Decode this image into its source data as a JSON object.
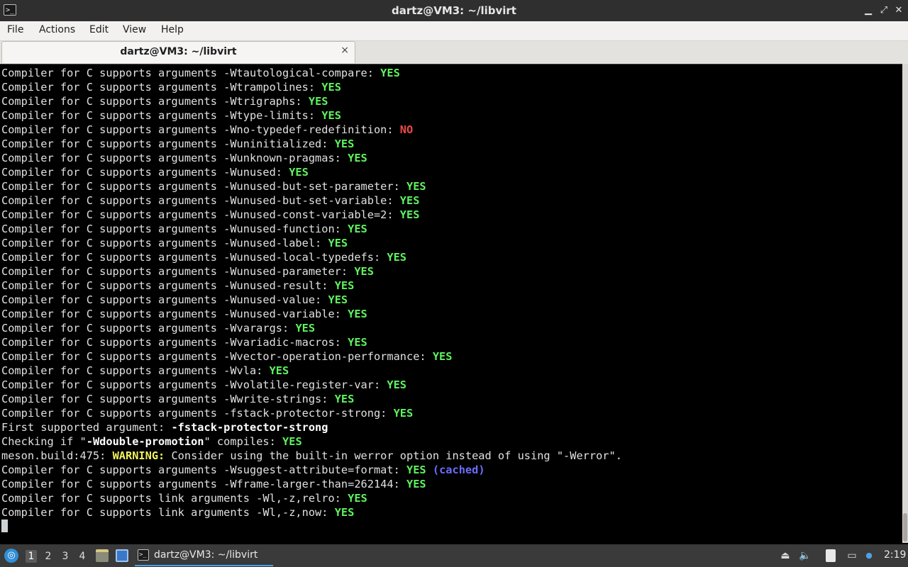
{
  "window": {
    "title": "dartz@VM3: ~/libvirt",
    "icon": "terminal-icon",
    "controls": {
      "minimize": "▁",
      "restore": "⤢",
      "close": "✕"
    }
  },
  "menubar": {
    "items": [
      "File",
      "Actions",
      "Edit",
      "View",
      "Help"
    ]
  },
  "tab": {
    "label": "dartz@VM3: ~/libvirt",
    "close": "×"
  },
  "terminal": {
    "colors": {
      "yes": "#5ef35e",
      "no": "#f04848",
      "warning": "#f2f25c",
      "cached": "#6c6cff",
      "text": "#e0e0e0"
    },
    "lines": [
      [
        {
          "t": "Compiler for C supports arguments -Wtautological-compare: "
        },
        {
          "t": "YES",
          "c": "yes"
        }
      ],
      [
        {
          "t": "Compiler for C supports arguments -Wtrampolines: "
        },
        {
          "t": "YES",
          "c": "yes"
        }
      ],
      [
        {
          "t": "Compiler for C supports arguments -Wtrigraphs: "
        },
        {
          "t": "YES",
          "c": "yes"
        }
      ],
      [
        {
          "t": "Compiler for C supports arguments -Wtype-limits: "
        },
        {
          "t": "YES",
          "c": "yes"
        }
      ],
      [
        {
          "t": "Compiler for C supports arguments -Wno-typedef-redefinition: "
        },
        {
          "t": "NO",
          "c": "no"
        }
      ],
      [
        {
          "t": "Compiler for C supports arguments -Wuninitialized: "
        },
        {
          "t": "YES",
          "c": "yes"
        }
      ],
      [
        {
          "t": "Compiler for C supports arguments -Wunknown-pragmas: "
        },
        {
          "t": "YES",
          "c": "yes"
        }
      ],
      [
        {
          "t": "Compiler for C supports arguments -Wunused: "
        },
        {
          "t": "YES",
          "c": "yes"
        }
      ],
      [
        {
          "t": "Compiler for C supports arguments -Wunused-but-set-parameter: "
        },
        {
          "t": "YES",
          "c": "yes"
        }
      ],
      [
        {
          "t": "Compiler for C supports arguments -Wunused-but-set-variable: "
        },
        {
          "t": "YES",
          "c": "yes"
        }
      ],
      [
        {
          "t": "Compiler for C supports arguments -Wunused-const-variable=2: "
        },
        {
          "t": "YES",
          "c": "yes"
        }
      ],
      [
        {
          "t": "Compiler for C supports arguments -Wunused-function: "
        },
        {
          "t": "YES",
          "c": "yes"
        }
      ],
      [
        {
          "t": "Compiler for C supports arguments -Wunused-label: "
        },
        {
          "t": "YES",
          "c": "yes"
        }
      ],
      [
        {
          "t": "Compiler for C supports arguments -Wunused-local-typedefs: "
        },
        {
          "t": "YES",
          "c": "yes"
        }
      ],
      [
        {
          "t": "Compiler for C supports arguments -Wunused-parameter: "
        },
        {
          "t": "YES",
          "c": "yes"
        }
      ],
      [
        {
          "t": "Compiler for C supports arguments -Wunused-result: "
        },
        {
          "t": "YES",
          "c": "yes"
        }
      ],
      [
        {
          "t": "Compiler for C supports arguments -Wunused-value: "
        },
        {
          "t": "YES",
          "c": "yes"
        }
      ],
      [
        {
          "t": "Compiler for C supports arguments -Wunused-variable: "
        },
        {
          "t": "YES",
          "c": "yes"
        }
      ],
      [
        {
          "t": "Compiler for C supports arguments -Wvarargs: "
        },
        {
          "t": "YES",
          "c": "yes"
        }
      ],
      [
        {
          "t": "Compiler for C supports arguments -Wvariadic-macros: "
        },
        {
          "t": "YES",
          "c": "yes"
        }
      ],
      [
        {
          "t": "Compiler for C supports arguments -Wvector-operation-performance: "
        },
        {
          "t": "YES",
          "c": "yes"
        }
      ],
      [
        {
          "t": "Compiler for C supports arguments -Wvla: "
        },
        {
          "t": "YES",
          "c": "yes"
        }
      ],
      [
        {
          "t": "Compiler for C supports arguments -Wvolatile-register-var: "
        },
        {
          "t": "YES",
          "c": "yes"
        }
      ],
      [
        {
          "t": "Compiler for C supports arguments -Wwrite-strings: "
        },
        {
          "t": "YES",
          "c": "yes"
        }
      ],
      [
        {
          "t": "Compiler for C supports arguments -fstack-protector-strong: "
        },
        {
          "t": "YES",
          "c": "yes"
        }
      ],
      [
        {
          "t": "First supported argument: "
        },
        {
          "t": "-fstack-protector-strong",
          "c": "boldw"
        }
      ],
      [
        {
          "t": "Checking if \""
        },
        {
          "t": "-Wdouble-promotion",
          "c": "boldw"
        },
        {
          "t": "\" compiles: "
        },
        {
          "t": "YES",
          "c": "yes"
        }
      ],
      [
        {
          "t": "meson.build:475: "
        },
        {
          "t": "WARNING:",
          "c": "warn"
        },
        {
          "t": " Consider using the built-in werror option instead of using \"-Werror\"."
        }
      ],
      [
        {
          "t": "Compiler for C supports arguments -Wsuggest-attribute=format: "
        },
        {
          "t": "YES",
          "c": "yes"
        },
        {
          "t": " "
        },
        {
          "t": "(cached)",
          "c": "cached"
        }
      ],
      [
        {
          "t": "Compiler for C supports arguments -Wframe-larger-than=262144: "
        },
        {
          "t": "YES",
          "c": "yes"
        }
      ],
      [
        {
          "t": "Compiler for C supports link arguments -Wl,-z,relro: "
        },
        {
          "t": "YES",
          "c": "yes"
        }
      ],
      [
        {
          "t": "Compiler for C supports link arguments -Wl,-z,now: "
        },
        {
          "t": "YES",
          "c": "yes"
        }
      ]
    ]
  },
  "taskbar": {
    "start_icon": "lxqt-start-icon",
    "workspaces": [
      "1",
      "2",
      "3",
      "4"
    ],
    "active_workspace": "1",
    "quicklaunch": [
      "file-manager-icon",
      "desktop-icon"
    ],
    "task": {
      "label": "dartz@VM3: ~/libvirt",
      "icon": "terminal-icon"
    },
    "tray": [
      "removable-media-icon",
      "volume-icon",
      "clipboard-icon",
      "network-icon",
      "notification-icon"
    ],
    "clock": "2:19"
  }
}
